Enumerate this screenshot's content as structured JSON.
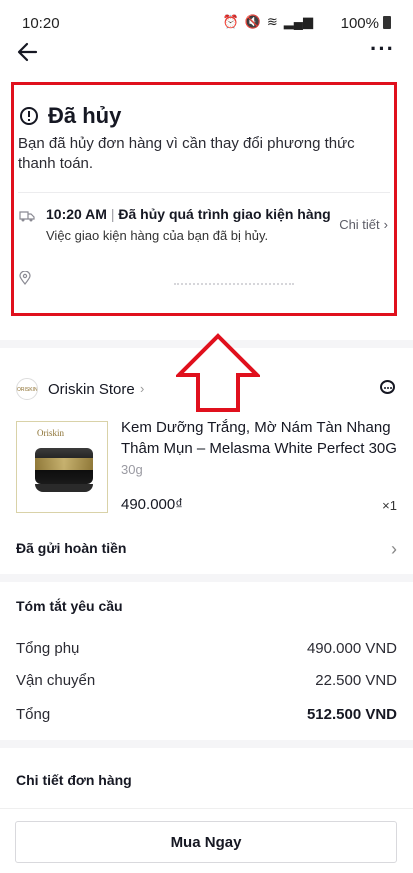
{
  "status_bar": {
    "time": "10:20",
    "battery": "100%",
    "icons": [
      "alarm-icon",
      "mute-icon",
      "wifi-icon",
      "signal-icon",
      "battery-icon"
    ]
  },
  "cancel": {
    "title": "Đã hủy",
    "reason": "Bạn đã hủy đơn hàng vì cần thay đổi phương thức thanh toán.",
    "tracking_time": "10:20 AM",
    "tracking_status": "Đã hủy quá trình giao kiện hàng",
    "tracking_desc": "Việc giao kiện hàng của bạn đã bị hủy.",
    "detail_link": "Chi tiết",
    "highlight_color": "#e0101d"
  },
  "store": {
    "name": "Oriskin Store",
    "avatar_text": "ORISKIN"
  },
  "product": {
    "image_brand": "Oriskin",
    "name": "Kem Dưỡng Trắng, Mờ Nám Tàn Nhang Thâm Mụn – Melasma White Perfect 30G",
    "variant": "30g",
    "price": "490.000₫",
    "quantity": "×1"
  },
  "refund": {
    "label": "Đã gửi hoàn tiền"
  },
  "summary": {
    "title": "Tóm tắt yêu cầu",
    "rows": [
      {
        "label": "Tổng phụ",
        "value": "490.000 VND"
      },
      {
        "label": "Vận chuyển",
        "value": "22.500 VND"
      },
      {
        "label": "Tổng",
        "value": "512.500 VND"
      }
    ]
  },
  "order_details": {
    "title": "Chi tiết đơn hàng"
  },
  "bottom": {
    "buy_label": "Mua Ngay"
  }
}
